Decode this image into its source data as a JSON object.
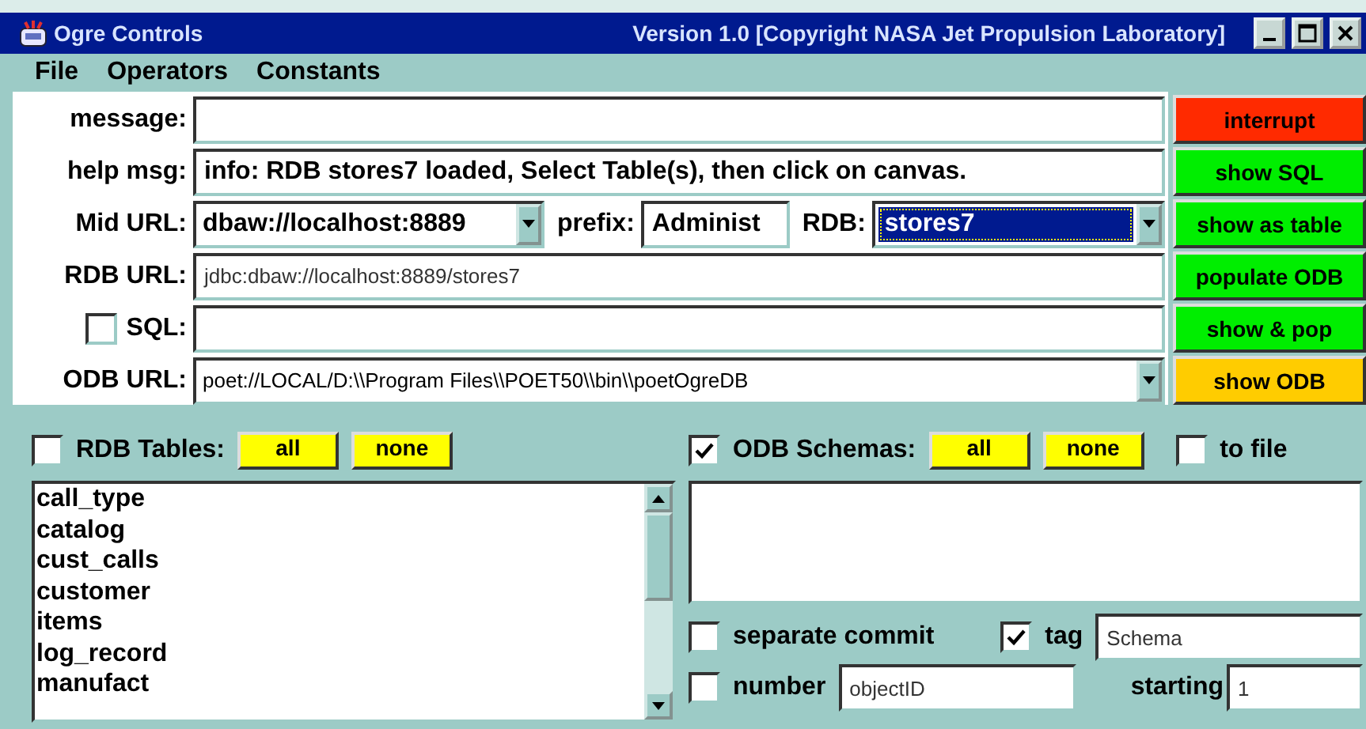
{
  "window": {
    "title": "Ogre Controls",
    "version": "Version 1.0 [Copyright NASA Jet Propulsion Laboratory]"
  },
  "menu": [
    "File",
    "Operators",
    "Constants"
  ],
  "form": {
    "message": {
      "label": "message:"
    },
    "help_msg": {
      "label": "help msg:",
      "value": "info: RDB stores7 loaded, Select Table(s), then click on canvas."
    },
    "mid_url": {
      "label": "Mid URL:",
      "value": "dbaw://localhost:8889"
    },
    "prefix": {
      "label": "prefix:",
      "value": "Administ"
    },
    "rdb": {
      "label": "RDB:",
      "value": "stores7",
      "focused": true
    },
    "rdb_url": {
      "label": "RDB URL:",
      "value": "jdbc:dbaw://localhost:8889/stores7"
    },
    "sql": {
      "label": "SQL:",
      "checked": false
    },
    "odb_url": {
      "label": "ODB URL:",
      "value": "poet://LOCAL/D:\\\\Program Files\\\\POET50\\\\bin\\\\poetOgreDB"
    }
  },
  "buttons": [
    {
      "label": "interrupt",
      "color": "#ff2a00"
    },
    {
      "label": "show SQL",
      "color": "#00ee00"
    },
    {
      "label": "show as table",
      "color": "#00ee00"
    },
    {
      "label": "populate ODB",
      "color": "#00ee00"
    },
    {
      "label": "show & pop",
      "color": "#00ee00"
    },
    {
      "label": "show ODB",
      "color": "#ffcc00"
    }
  ],
  "rdb_tables": {
    "label": "RDB Tables:",
    "checked": false,
    "buttons": [
      "all",
      "none"
    ],
    "items": [
      {
        "label": "call_type",
        "selected": false
      },
      {
        "label": "catalog",
        "selected": false
      },
      {
        "label": "cust_calls",
        "selected": false
      },
      {
        "label": "customer",
        "selected": false
      },
      {
        "label": "items",
        "selected": false
      },
      {
        "label": "log_record",
        "selected": false
      },
      {
        "label": "manufact",
        "selected": false
      }
    ]
  },
  "odb_schemas": {
    "label": "ODB Schemas:",
    "checked": true,
    "buttons": [
      "all",
      "none"
    ],
    "to_file": {
      "label": "to file",
      "checked": false
    },
    "separate_commit": {
      "label": "separate commit",
      "checked": false
    },
    "tag": {
      "label": "tag",
      "checked": true,
      "value": "Schema"
    },
    "number": {
      "label": "number",
      "checked": false,
      "value": "objectID"
    },
    "starting": {
      "label": "starting",
      "value": "1"
    }
  }
}
